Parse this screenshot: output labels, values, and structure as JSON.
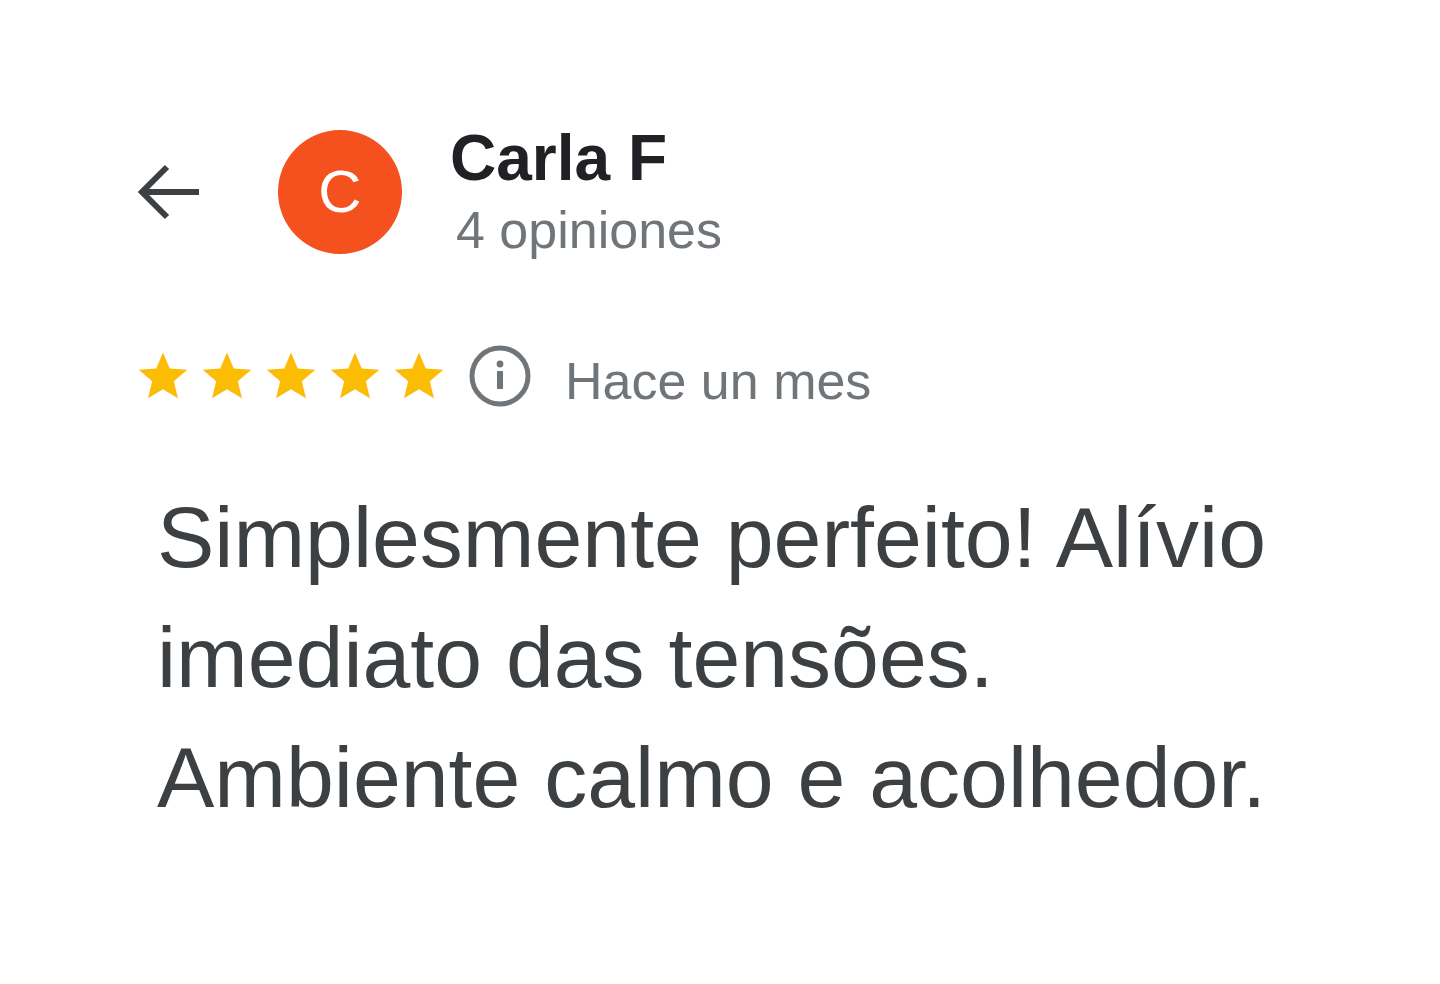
{
  "header": {
    "reviewer_name": "Carla F",
    "avatar_initial": "C",
    "review_count": "4 opiniones"
  },
  "review": {
    "stars": 5,
    "time": "Hace un mes",
    "text": "Simplesmente perfeito! Alívio imediato das tensões. Ambiente calmo e acolhedor."
  }
}
